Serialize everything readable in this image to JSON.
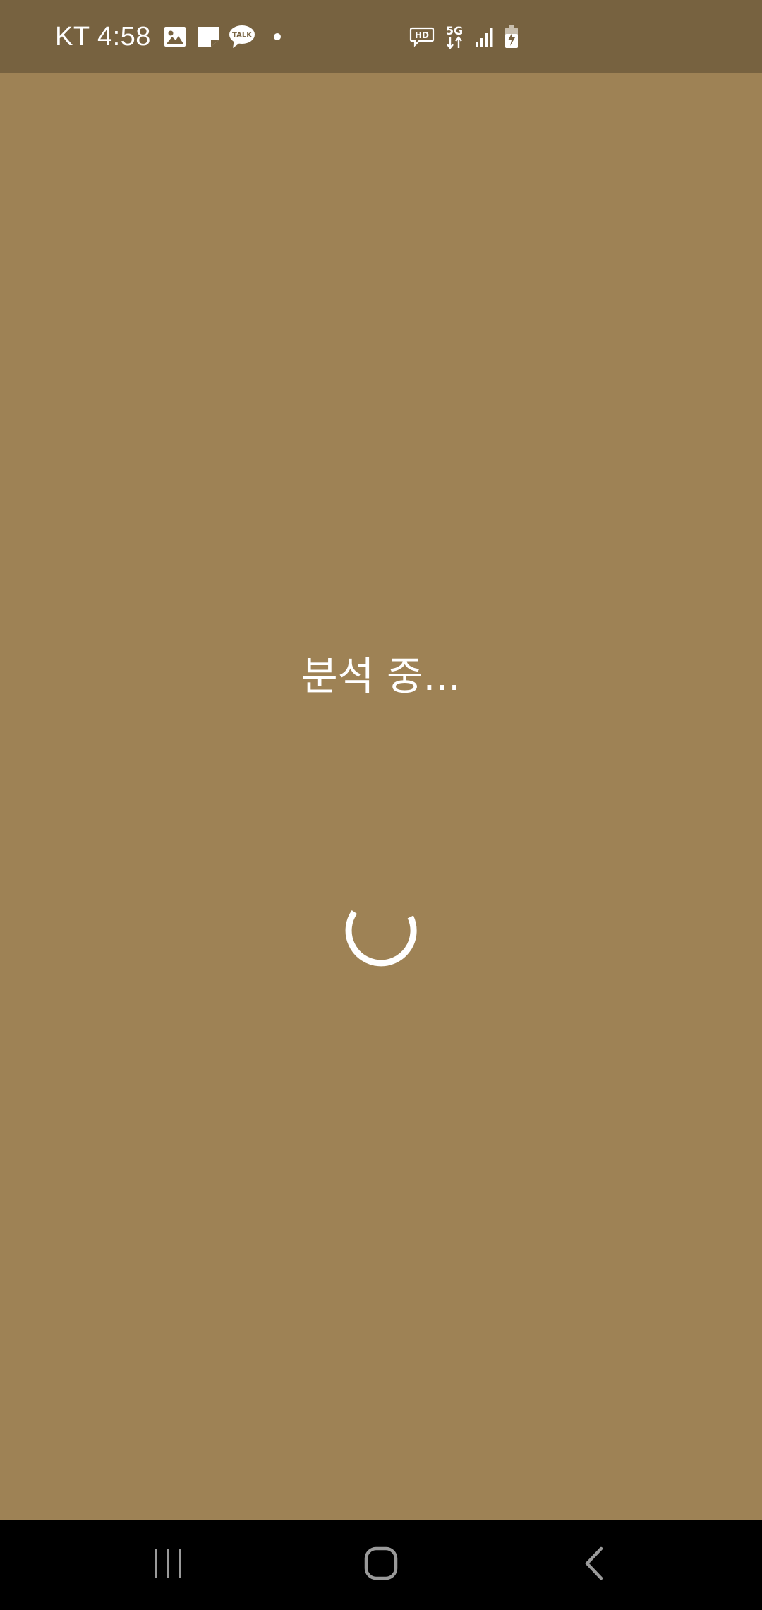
{
  "status_bar": {
    "carrier": "KT",
    "time": "4:58",
    "notification_icons": [
      "gallery-icon",
      "memo-icon",
      "kakaotalk-icon",
      "more-notifications-dot"
    ],
    "kakaotalk_badge_text": "TALK",
    "hd_label": "HD",
    "network_label": "5G",
    "system_icons": [
      "hd-voice-icon",
      "5g-data-icon",
      "signal-strength-icon",
      "battery-charging-icon"
    ]
  },
  "main": {
    "loading_text": "분석 중...",
    "spinner_icon": "loading-spinner-icon"
  },
  "nav_bar": {
    "buttons": [
      "recent-apps-icon",
      "home-icon",
      "back-icon"
    ]
  },
  "colors": {
    "background": "#9E8255",
    "status_bar_background": "#776240",
    "nav_bar_background": "#000000",
    "text": "#FFFFFF",
    "nav_icon": "#9A9A9A"
  }
}
